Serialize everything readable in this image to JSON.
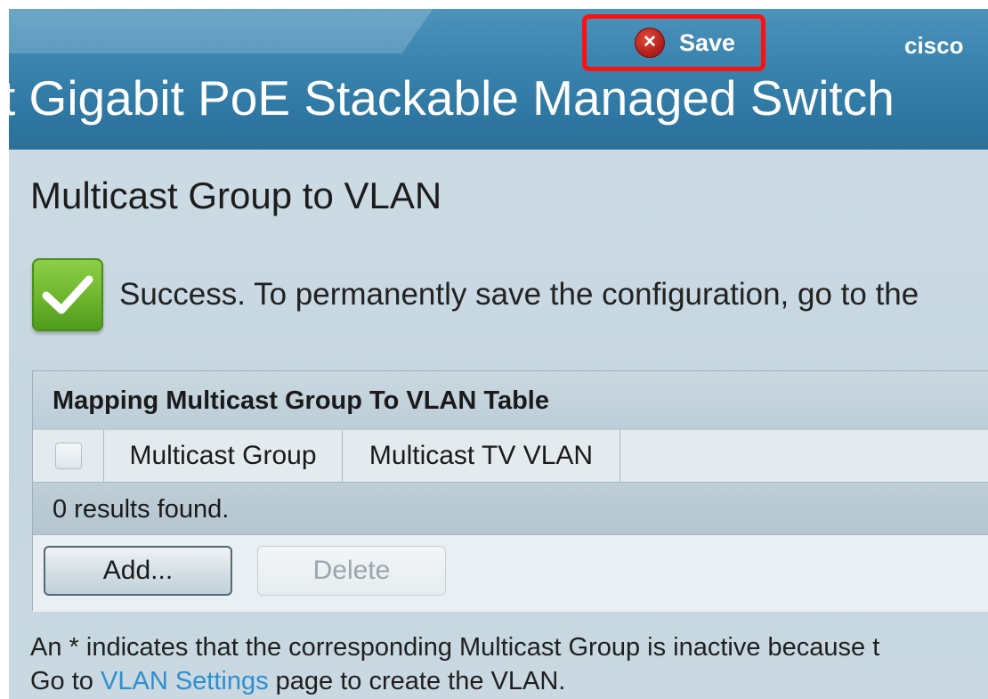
{
  "header": {
    "save_label": "Save",
    "save_icon": "close-circle-icon",
    "brand": "cisco",
    "product_title": "t Gigabit PoE Stackable Managed Switch",
    "highlight_color": "#ff1010"
  },
  "page": {
    "title": "Multicast Group to VLAN"
  },
  "status": {
    "icon": "checkmark-icon",
    "message": "Success. To permanently save the configuration, go to the",
    "color": "#6db52d"
  },
  "table": {
    "title": "Mapping Multicast Group To VLAN Table",
    "columns": [
      "Multicast Group",
      "Multicast TV VLAN"
    ],
    "rows": [],
    "empty_text": "0 results found.",
    "buttons": {
      "add": "Add...",
      "delete": "Delete"
    }
  },
  "note": {
    "line1": "An * indicates that the corresponding Multicast Group is inactive because t",
    "line2_prefix": "Go to ",
    "link": "VLAN Settings",
    "line2_suffix": " page to create the VLAN.",
    "link_color": "#2f8fce"
  }
}
